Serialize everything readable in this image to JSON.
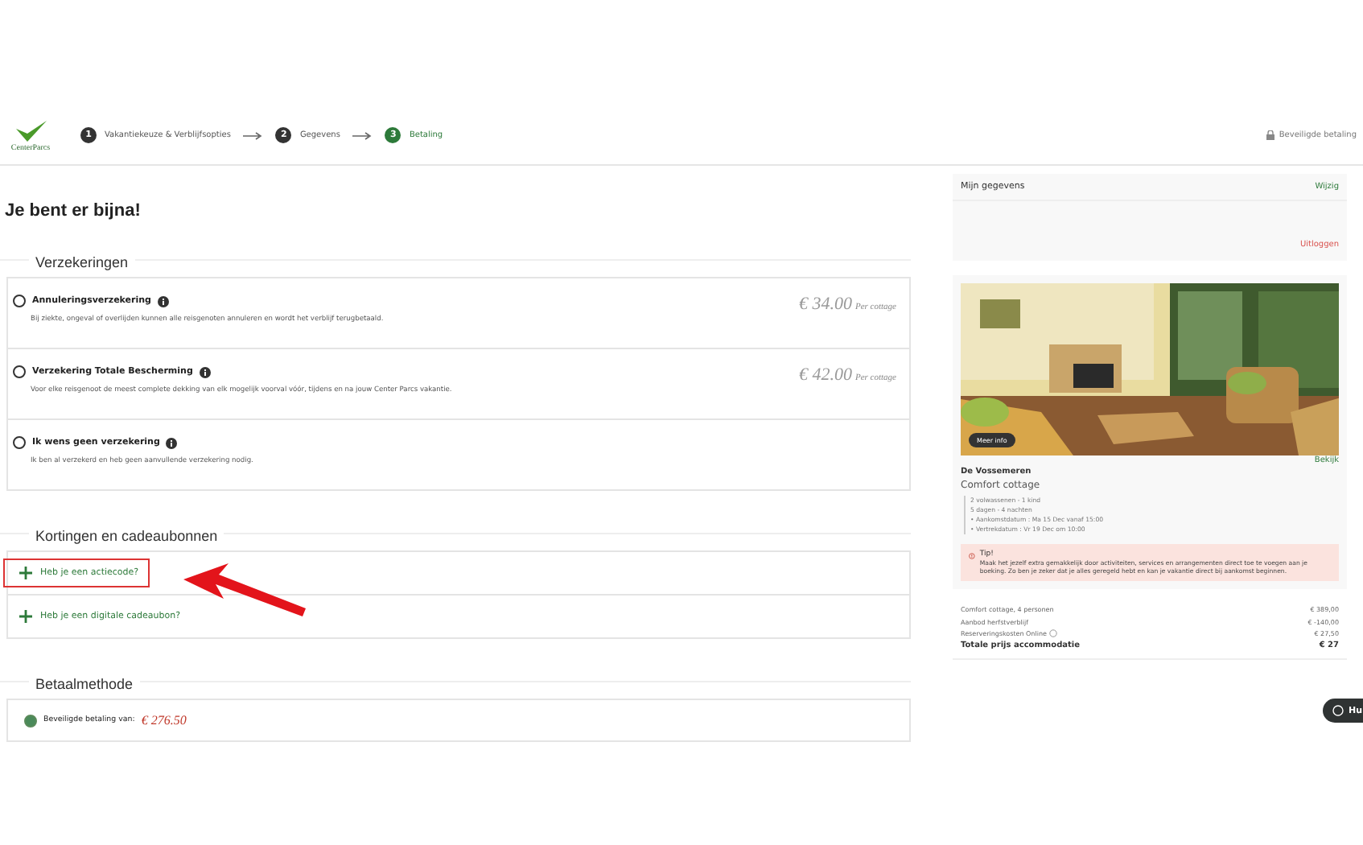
{
  "header": {
    "logo_text": "CenterParcs",
    "steps": [
      {
        "number": "1",
        "label": "Vakantiekeuze & Verblijfsopties",
        "selected": false
      },
      {
        "number": "2",
        "label": "Gegevens",
        "selected": false
      },
      {
        "number": "3",
        "label": "Betaling",
        "selected": true
      }
    ],
    "secure_label": "Beveiligde betaling"
  },
  "page_title": "Je bent er bijna!",
  "insurance": {
    "title": "Verzekeringen",
    "options": [
      {
        "label": "Annuleringsverzekering",
        "description": "Bij ziekte, ongeval of overlijden kunnen alle reisgenoten annuleren en wordt het verblijf terugbetaald.",
        "price": "€ 34.00",
        "unit": "Per cottage",
        "selected": false
      },
      {
        "label": "Verzekering Totale Bescherming",
        "description": "Voor elke reisgenoot de meest complete dekking van elk mogelijk voorval vóór, tijdens en na jouw Center Parcs vakantie.",
        "price": "€ 42.00",
        "unit": "Per cottage",
        "selected": false
      },
      {
        "label": "Ik wens geen verzekering",
        "description": "Ik ben al verzekerd en heb geen aanvullende verzekering nodig.",
        "selected": false
      }
    ]
  },
  "discounts": {
    "title": "Kortingen en cadeaubonnen",
    "links": [
      {
        "label": "Heb je een actiecode?",
        "highlighted": true
      },
      {
        "label": "Heb je een digitale cadeaubon?",
        "highlighted": false
      }
    ]
  },
  "payment": {
    "title": "Betaalmethode",
    "options": [
      {
        "label": "Beveiligde betaling van:",
        "amount": "€ 276.50",
        "selected": true
      }
    ]
  },
  "sidebar": {
    "account": {
      "title": "Mijn gegevens",
      "edit": "Wijzig",
      "logout": "Uitloggen"
    },
    "accommodation": {
      "photo_button": "Meer info",
      "view_link": "Bekijk",
      "park": "De Vossemeren",
      "type": "Comfort cottage",
      "details": [
        "2 volwassenen - 1 kind",
        "5 dagen - 4 nachten",
        "• Aankomstdatum : Ma 15 Dec vanaf 15:00",
        "• Vertrekdatum : Vr 19 Dec om 10:00"
      ],
      "tip": {
        "title": "Tip!",
        "text": "Maak het jezelf extra gemakkelijk door activiteiten, services en arrangementen direct toe te voegen aan je boeking. Zo ben je zeker dat je alles geregeld hebt en kan je vakantie direct bij aankomst beginnen."
      }
    },
    "prices": {
      "rows": [
        {
          "label": "Comfort cottage, 4 personen",
          "amount": "€ 389,00",
          "info": false
        },
        {
          "label": "Aanbod herfstverblijf",
          "amount": "€ -140,00",
          "info": false
        },
        {
          "label": "Reserveringskosten Online",
          "amount": "€ 27,50",
          "info": true
        }
      ],
      "total": {
        "label": "Totale prijs accommodatie",
        "amount": "€ 27"
      }
    }
  },
  "help_button": "Hu"
}
